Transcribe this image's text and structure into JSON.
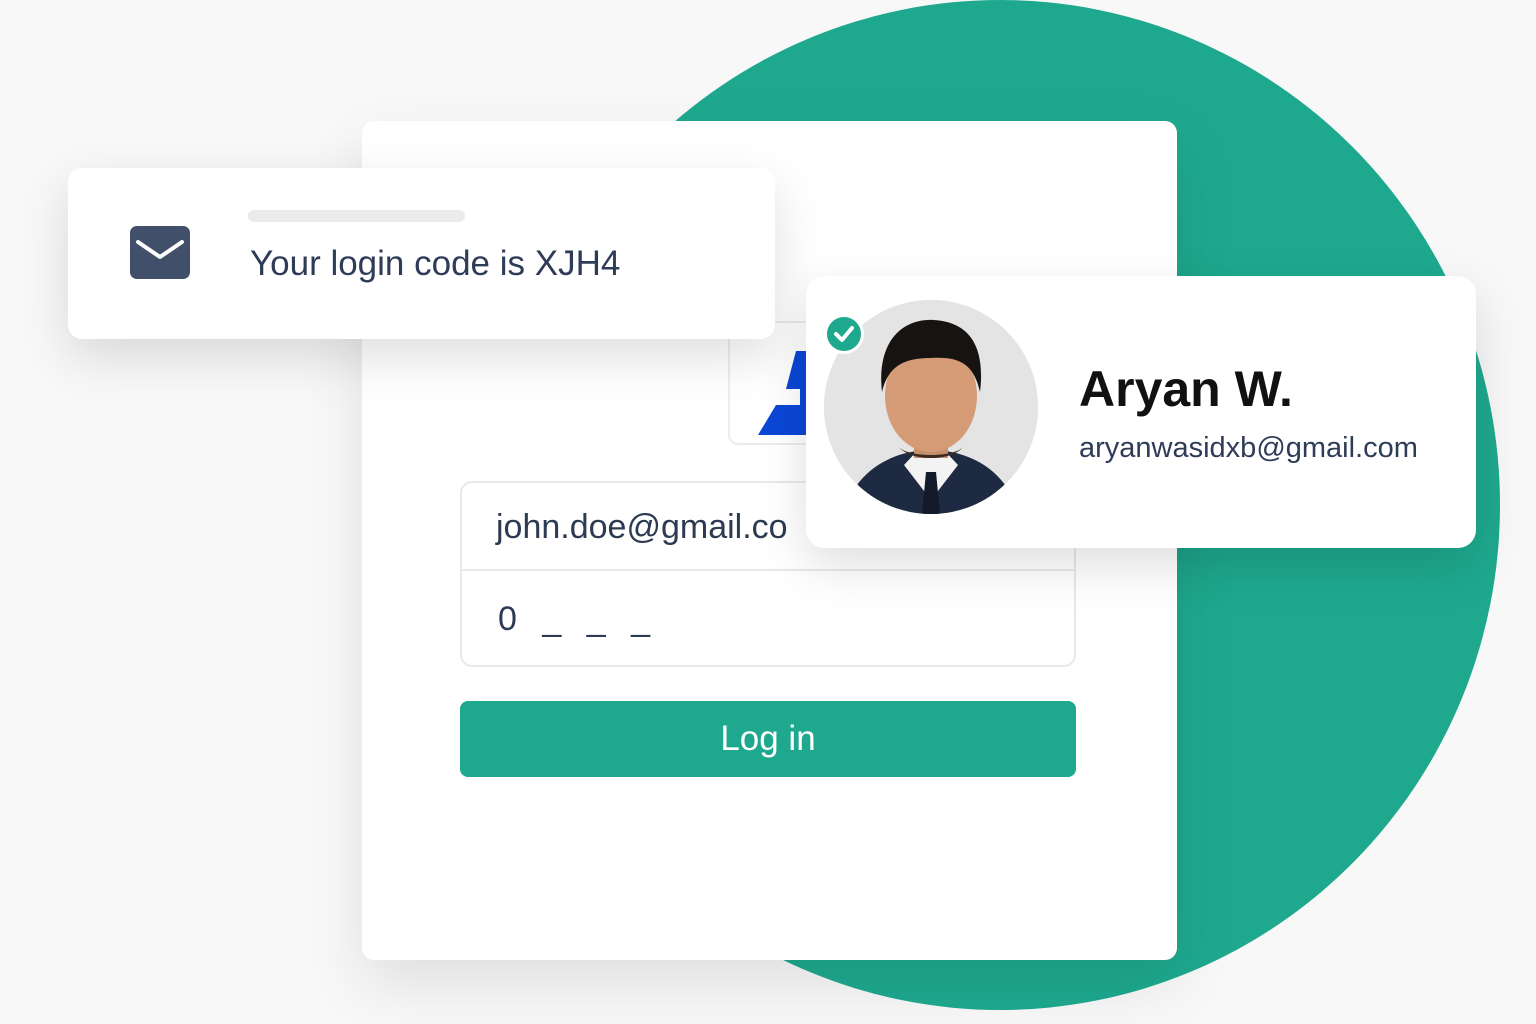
{
  "login_card": {
    "email_value": "john.doe@gmail.co",
    "code_value": "0 _ _ _",
    "login_button_label": "Log in"
  },
  "notification": {
    "text": "Your login code is XJH4",
    "icon": "mail-icon"
  },
  "profile": {
    "name": "Aryan W.",
    "email": "aryanwasidxb@gmail.com",
    "verified_icon": "check-circle-icon"
  },
  "colors": {
    "accent": "#1ea98e",
    "background": "#f8f8f8",
    "text_dark": "#2f3c57",
    "logo_blue": "#0b47d6"
  }
}
